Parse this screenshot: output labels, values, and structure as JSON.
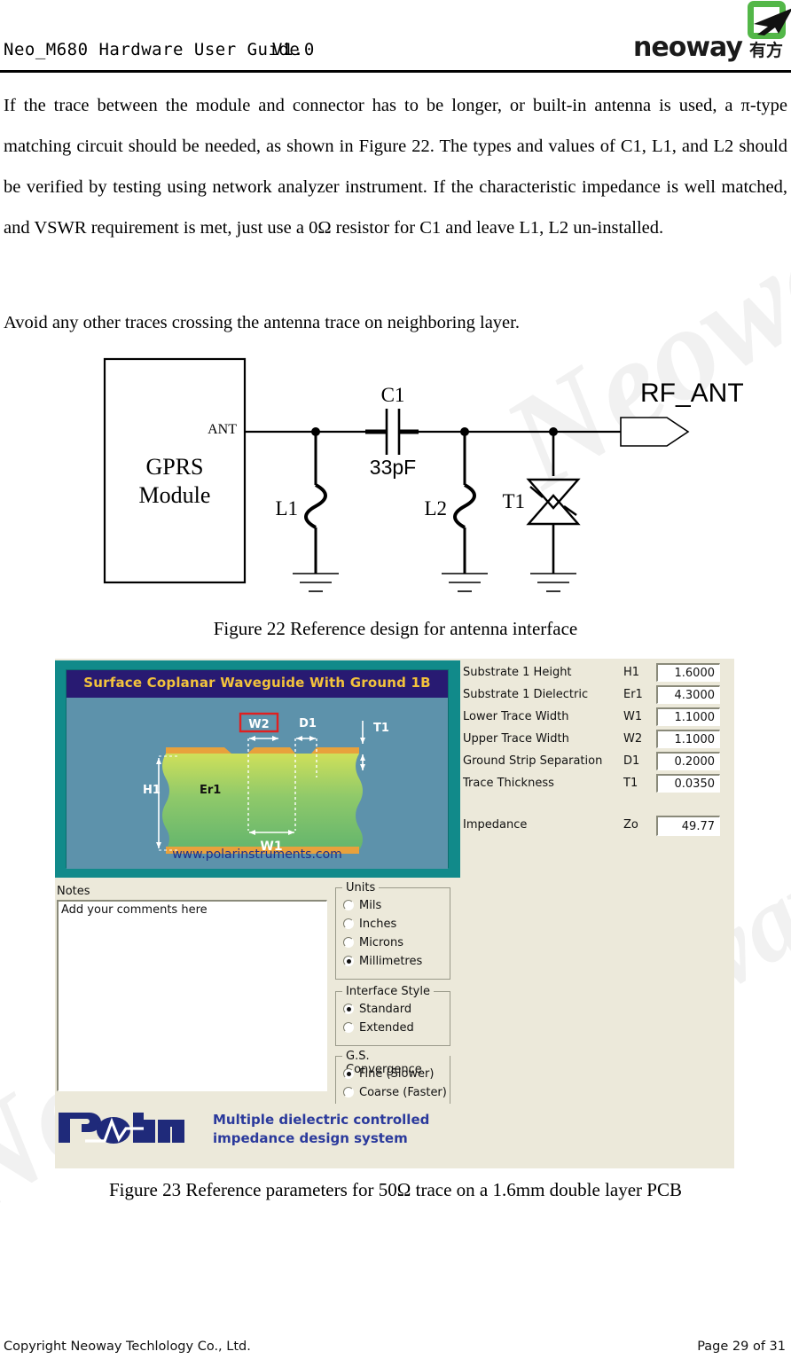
{
  "header": {
    "title": "Neo_M680 Hardware User Guide",
    "version": "V1.0",
    "logo_word": "neoway",
    "logo_cn": "有方",
    "logo_green": "#53b748"
  },
  "body": {
    "paragraph1": "If the trace between the module and connector has to be longer, or built-in antenna is used, a π-type matching circuit should be needed, as shown in Figure 22. The types and values of C1, L1, and L2 should be verified by testing using network analyzer instrument. If the characteristic impedance is well matched, and VSWR requirement is met, just use a 0Ω resistor for C1 and leave L1, L2 un-installed.",
    "paragraph2": "Avoid any other traces crossing the antenna trace on neighboring layer."
  },
  "figure22": {
    "caption": "Figure 22 Reference design for antenna interface",
    "module_line1": "GPRS",
    "module_line2": "Module",
    "pin_label": "ANT",
    "cap_ref": "C1",
    "cap_value": "33pF",
    "ind1_ref": "L1",
    "ind2_ref": "L2",
    "tvs_ref": "T1",
    "port_label": "RF_ANT"
  },
  "figure23": {
    "caption": "Figure 23 Reference parameters for 50Ω trace on a 1.6mm double layer PCB",
    "diagram": {
      "title": "Surface Coplanar Waveguide With Ground 1B",
      "url": "www.polarinstruments.com",
      "labels": {
        "w2": "W2",
        "d1": "D1",
        "t1": "T1",
        "h1": "H1",
        "er1": "Er1",
        "w1": "W1"
      },
      "title_bg": "#281a72",
      "title_fg": "#f3c33c",
      "panel_bg": "#118a8a",
      "canvas_bg": "#5d92ab"
    },
    "parameters": [
      {
        "label": "Substrate 1 Height",
        "symbol": "H1",
        "value": "1.6000"
      },
      {
        "label": "Substrate 1 Dielectric",
        "symbol": "Er1",
        "value": "4.3000"
      },
      {
        "label": "Lower Trace Width",
        "symbol": "W1",
        "value": "1.1000"
      },
      {
        "label": "Upper Trace Width",
        "symbol": "W2",
        "value": "1.1000"
      },
      {
        "label": "Ground Strip Separation",
        "symbol": "D1",
        "value": "0.2000"
      },
      {
        "label": "Trace Thickness",
        "symbol": "T1",
        "value": "0.0350"
      }
    ],
    "impedance": {
      "label": "Impedance",
      "symbol": "Zo",
      "value": "49.77"
    },
    "notes": {
      "label": "Notes",
      "text": "Add your comments here"
    },
    "units": {
      "title": "Units",
      "options": [
        {
          "label": "Mils",
          "selected": false
        },
        {
          "label": "Inches",
          "selected": false
        },
        {
          "label": "Microns",
          "selected": false
        },
        {
          "label": "Millimetres",
          "selected": true
        }
      ]
    },
    "interface_style": {
      "title": "Interface Style",
      "options": [
        {
          "label": "Standard",
          "selected": true
        },
        {
          "label": "Extended",
          "selected": false
        }
      ]
    },
    "convergence": {
      "title": "G.S. Convergence",
      "options": [
        {
          "label": "Fine (Slower)",
          "selected": true
        },
        {
          "label": "Coarse (Faster)",
          "selected": false
        }
      ]
    },
    "brand": {
      "name": "Polar",
      "tagline_line1": "Multiple dielectric controlled",
      "tagline_line2": "impedance design system",
      "color": "#2b3a9c"
    }
  },
  "footer": {
    "copyright": "Copyright Neoway Techlology Co., Ltd.",
    "page": "Page 29 of 31"
  },
  "watermark": {
    "text": "Neoway Ltd"
  }
}
